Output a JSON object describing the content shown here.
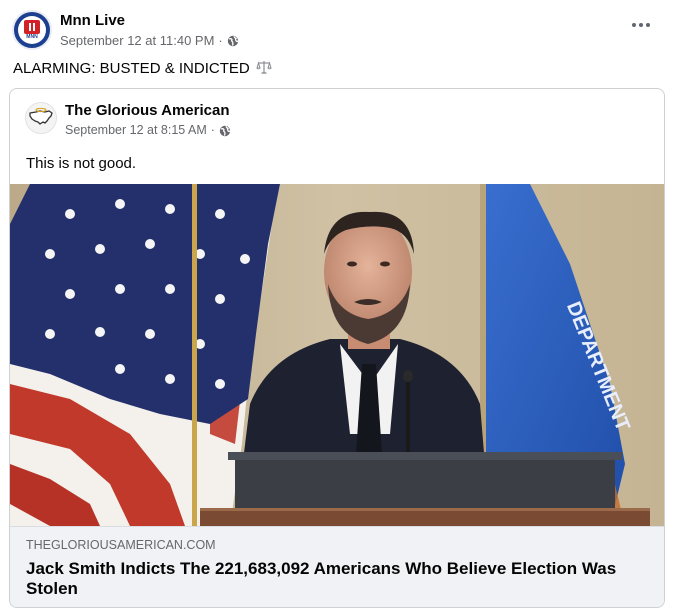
{
  "post": {
    "author": "Mnn Live",
    "avatar_text": "MNN",
    "timestamp": "September 12 at 11:40 PM",
    "separator": "·",
    "audience_icon": "globe-icon",
    "text": "ALARMING: BUSTED & INDICTED",
    "text_icon": "balance-scale-icon",
    "more_icon": "more-dots-icon"
  },
  "shared": {
    "author": "The Glorious American",
    "avatar_icon": "us-map-logo",
    "timestamp": "September 12 at 8:15 AM",
    "separator": "·",
    "text": "This is not good.",
    "link": {
      "domain": "THEGLORIOUSAMERICAN.COM",
      "headline": "Jack Smith Indicts The 221,683,092 Americans Who Believe Election Was Stolen"
    }
  },
  "colors": {
    "text_primary": "#050505",
    "text_secondary": "#65676b",
    "card_border": "#ced0d4",
    "link_bg": "#f0f2f5",
    "avatar_blue": "#1d3f8f",
    "avatar_red": "#d32227"
  }
}
